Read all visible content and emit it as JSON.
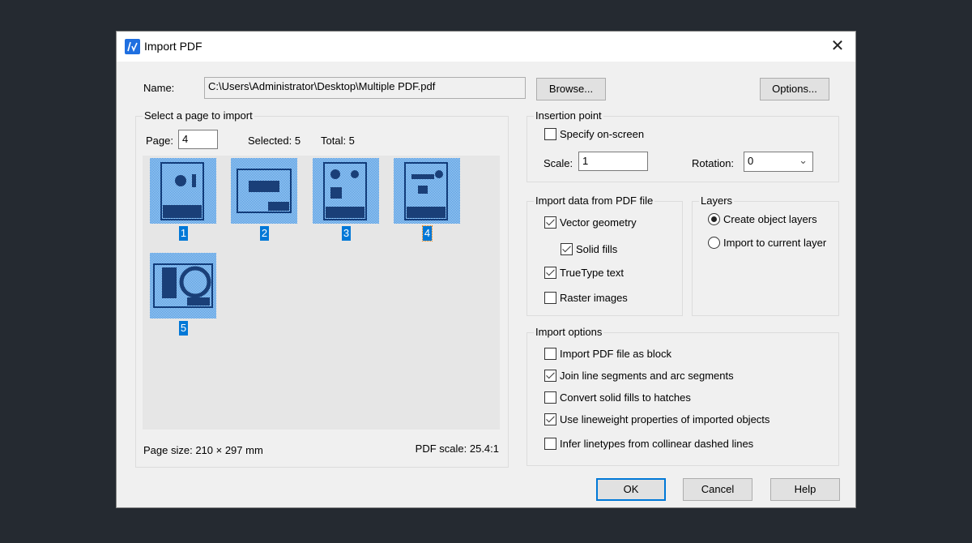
{
  "window": {
    "title": "Import PDF",
    "close_icon": "close-icon",
    "app_icon": "autocad-pdf-icon"
  },
  "name": {
    "label": "Name:",
    "value": "C:\\Users\\Administrator\\Desktop\\Multiple PDF.pdf",
    "browse": "Browse...",
    "options": "Options..."
  },
  "pages": {
    "group_label": "Select a page to import",
    "page_label": "Page:",
    "page_value": "4",
    "selected": "Selected: 5",
    "total": "Total: 5",
    "thumbnails": [
      {
        "label": "1",
        "selected": true
      },
      {
        "label": "2",
        "selected": true
      },
      {
        "label": "3",
        "selected": true
      },
      {
        "label": "4",
        "selected": true,
        "focused": true
      },
      {
        "label": "5",
        "selected": true
      }
    ],
    "page_size": "Page size: 210 × 297 mm",
    "pdf_scale": "PDF scale: 25.4:1"
  },
  "insertion": {
    "group_label": "Insertion point",
    "specify": {
      "label": "Specify on-screen",
      "checked": false
    },
    "scale_label": "Scale:",
    "scale_value": "1",
    "rotation_label": "Rotation:",
    "rotation_value": "0"
  },
  "import_data": {
    "group_label": "Import data from PDF file",
    "items": [
      {
        "label": "Vector geometry",
        "checked": true
      },
      {
        "label": "Solid fills",
        "checked": true
      },
      {
        "label": "TrueType text",
        "checked": true
      },
      {
        "label": "Raster images",
        "checked": false
      }
    ]
  },
  "layers": {
    "group_label": "Layers",
    "items": [
      {
        "label": "Create object layers",
        "selected": true
      },
      {
        "label": "Import to current layer",
        "selected": false
      }
    ]
  },
  "import_options": {
    "group_label": "Import options",
    "items": [
      {
        "label": "Import PDF file as block",
        "checked": false
      },
      {
        "label": "Join line segments and arc segments",
        "checked": true
      },
      {
        "label": "Convert solid fills to hatches",
        "checked": false
      },
      {
        "label": "Use lineweight properties of imported objects",
        "checked": true
      },
      {
        "label": "Infer linetypes from collinear dashed lines",
        "checked": false
      }
    ]
  },
  "buttons": {
    "ok": "OK",
    "cancel": "Cancel",
    "help": "Help"
  },
  "colors": {
    "accent": "#0078d7",
    "background": "#252a31",
    "dialog": "#f0f0f0"
  }
}
